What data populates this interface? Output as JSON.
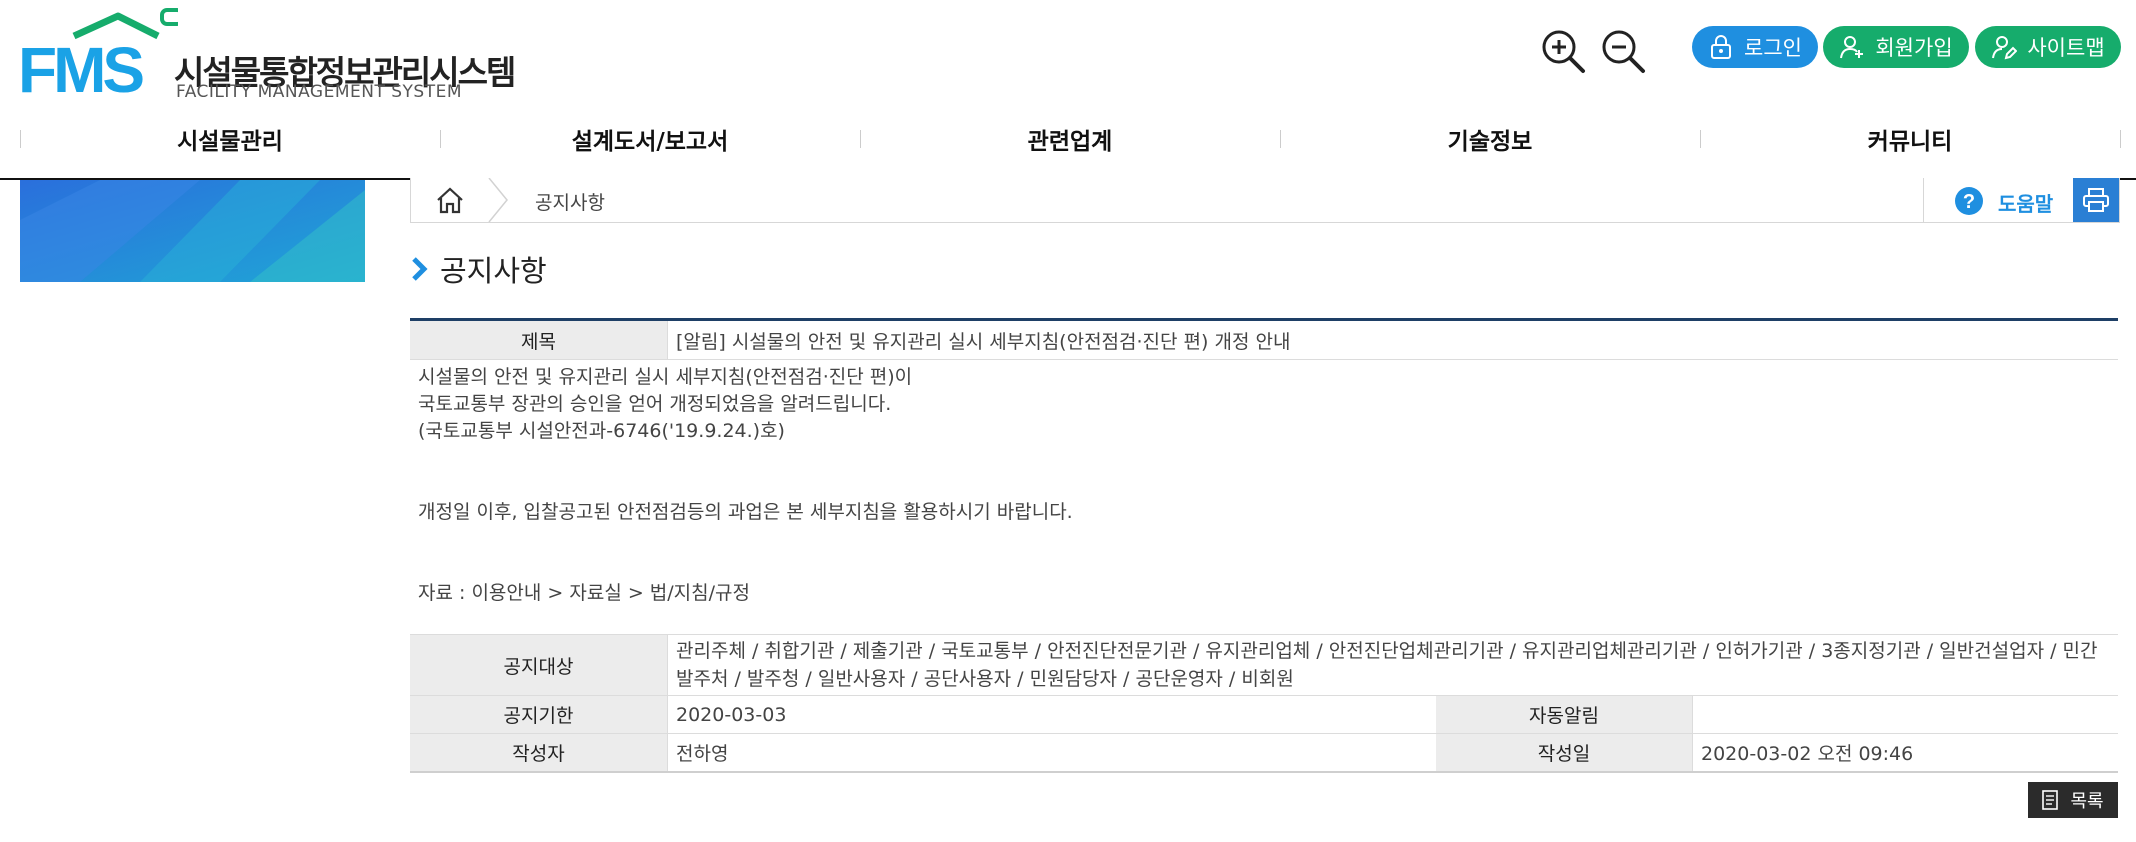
{
  "header": {
    "logo_mark": "FMS",
    "logo_name": "시설물통합정보관리시스템",
    "logo_sub": "FACILITY MANAGEMENT SYSTEM",
    "zoom_in_icon": "zoom-in-icon",
    "zoom_out_icon": "zoom-out-icon",
    "login_label": "로그인",
    "join_label": "회원가입",
    "sitemap_label": "사이트맵",
    "login_color": "#1f8fe0",
    "member_color": "#16ac6c"
  },
  "gnb": {
    "items": [
      "시설물관리",
      "설계도서/보고서",
      "관련업계",
      "기술정보",
      "커뮤니티"
    ]
  },
  "breadcrumb": {
    "home_icon": "home-icon",
    "current": "공지사항",
    "help_label": "도움말",
    "print_icon": "print-icon"
  },
  "page": {
    "title": "공지사항"
  },
  "notice": {
    "title_label": "제목",
    "title_value": "[알림] 시설물의 안전 및 유지관리 실시 세부지침(안전점검·진단 편) 개정 안내",
    "body": {
      "line1": "시설물의 안전 및 유지관리 실시 세부지침(안전점검·진단 편)이",
      "line2": "국토교통부 장관의 승인을 얻어 개정되었음을 알려드립니다.",
      "line3": "(국토교통부 시설안전과-6746('19.9.24.)호)",
      "line4": "개정일 이후, 입찰공고된 안전점검등의 과업은 본 세부지침을 활용하시기 바랍니다.",
      "line5": "자료 : 이용안내 > 자료실 > 법/지침/규정"
    },
    "target_label": "공지대상",
    "target_value": "관리주체 / 취합기관 / 제출기관 / 국토교통부 / 안전진단전문기관 / 유지관리업체 / 안전진단업체관리기관 / 유지관리업체관리기관 / 인허가기관 / 3종지정기관 / 일반건설업자 / 민간발주처 / 발주청 / 일반사용자 / 공단사용자 / 민원담당자 / 공단운영자 / 비회원",
    "deadline_label": "공지기한",
    "deadline_value": "2020-03-03",
    "auto_notify_label": "자동알림",
    "auto_notify_value": "",
    "author_label": "작성자",
    "author_value": "전하영",
    "date_label": "작성일",
    "date_value": "2020-03-02 오전 09:46"
  },
  "actions": {
    "list_label": "목록",
    "list_icon": "document-icon"
  }
}
